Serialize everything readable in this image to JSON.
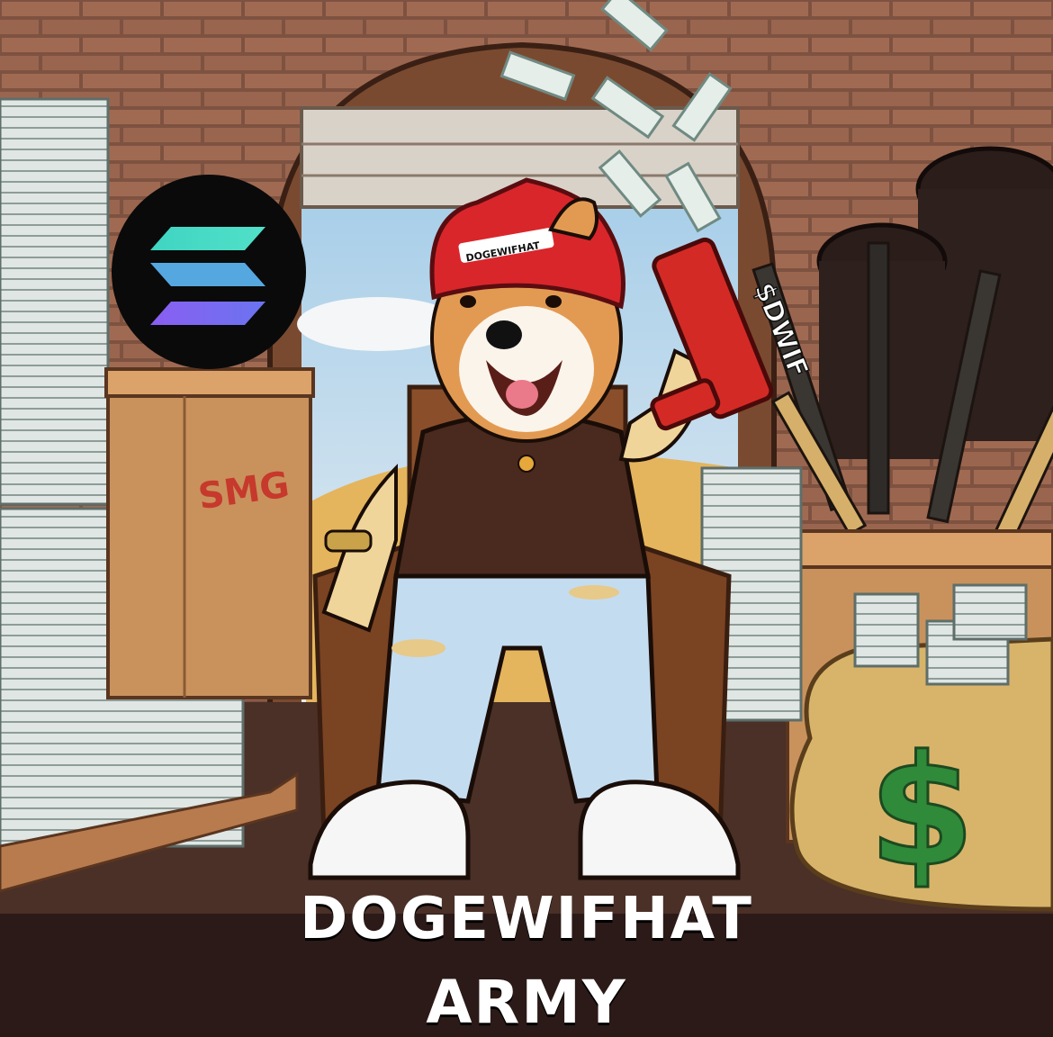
{
  "hat_label": "DOGEWIFHAT",
  "gun_label": "$DWIF",
  "crate_label": "SMG",
  "bag_symbol": "$",
  "caption_line1": "DOGEWIFHAT",
  "caption_line2": "ARMY",
  "icons": [
    "solana-logo-icon",
    "money-gun-icon",
    "money-bag-icon"
  ],
  "colors": {
    "brick": "#8a5a45",
    "hat_red": "#d9262b",
    "gun_red": "#d42a26",
    "solana_teal": "#3fd5c2",
    "solana_purple": "#8a5ef2",
    "bag_gold": "#d8b46a",
    "caption": "#ffffff"
  }
}
